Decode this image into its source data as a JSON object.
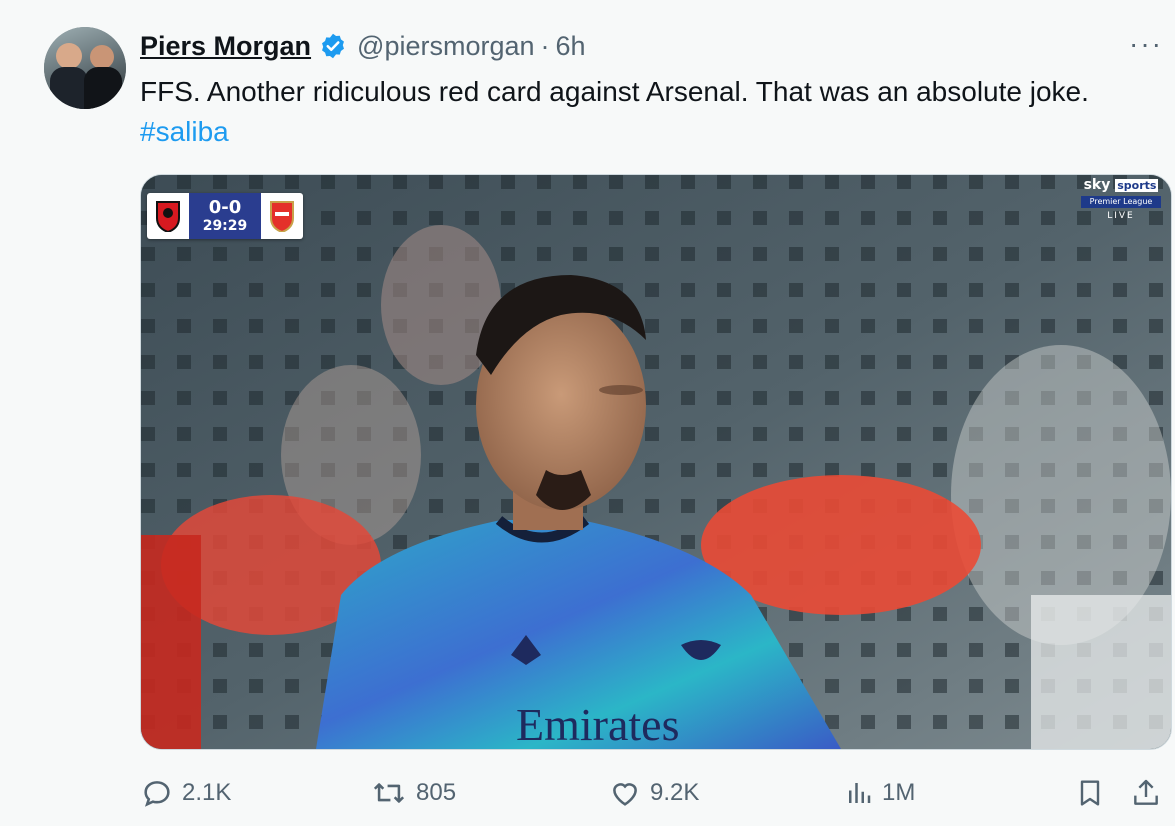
{
  "author": {
    "name": "Piers Morgan",
    "handle": "@piersmorgan",
    "separator": "·",
    "time": "6h",
    "verified": true,
    "avatar_icon": "profile-photo-icon"
  },
  "tweet": {
    "text": "FFS. Another ridiculous red card against Arsenal. That was an absolute joke.",
    "hashtag": "#saliba"
  },
  "media": {
    "scoreboard": {
      "score": "0-0",
      "clock": "29:29",
      "home_icon": "bournemouth-crest-icon",
      "away_icon": "arsenal-crest-icon"
    },
    "broadcaster": {
      "brand": "sky",
      "brand_suffix": "sports",
      "sub": "Premier League",
      "live": "LIVE"
    },
    "shirt_text": "Emirates"
  },
  "actions": {
    "replies": "2.1K",
    "reposts": "805",
    "likes": "9.2K",
    "views": "1M"
  },
  "colors": {
    "accent": "#1d9bf0",
    "muted": "#536471",
    "background": "#f7f9f9"
  }
}
